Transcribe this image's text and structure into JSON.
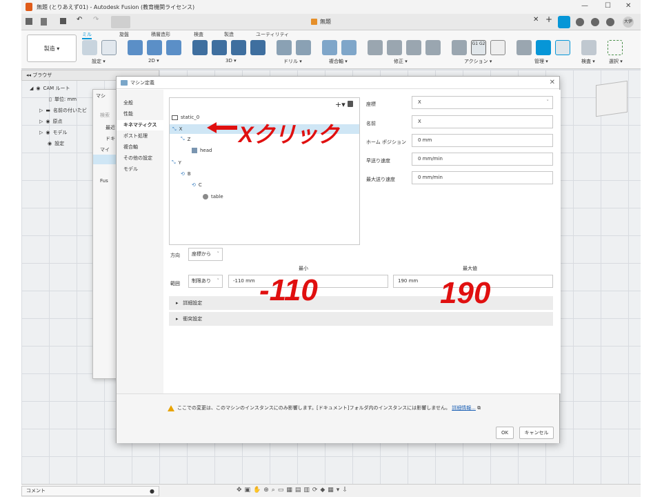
{
  "window": {
    "title": "無題 (とりあえず01) - Autodesk Fusion (教育機関ライセンス)",
    "doc_tab": "無題",
    "user_initials": "大伊"
  },
  "toolbar": {
    "workspace": "製造 ▾",
    "tabs": [
      "ミル",
      "旋盤",
      "積層造形",
      "検査",
      "製造",
      "ユーティリティ"
    ],
    "groups": [
      "設定 ▾",
      "2D ▾",
      "3D ▾",
      "ドリル ▾",
      "複合軸 ▾",
      "修正 ▾",
      "アクション ▾",
      "管理 ▾",
      "検査 ▾",
      "選択 ▾"
    ]
  },
  "browser": {
    "title": "ブラウザ",
    "items": [
      "CAM ルート",
      "単位: mm",
      "名前の付いたビ",
      "原点",
      "モデル",
      "設定"
    ]
  },
  "bg_dialog": {
    "title": "マシ",
    "labels": [
      "検索",
      "最近",
      "ドキ",
      "マイ",
      "Fus"
    ]
  },
  "dialog": {
    "title": "マシン定義",
    "sidebar": [
      "全般",
      "性能",
      "キネマティクス",
      "ポスト処理",
      "複合軸",
      "その他の設定",
      "モデル"
    ],
    "tree": [
      "static_0",
      "X",
      "Z",
      "head",
      "Y",
      "B",
      "C",
      "table"
    ],
    "props": {
      "axis_label": "座標",
      "axis_value": "X",
      "name_label": "名前",
      "name_value": "X",
      "home_label": "ホーム ポジション",
      "home_value": "0 mm",
      "rapid_label": "早送り速度",
      "rapid_value": "0 mm/min",
      "max_feed_label": "最大送り速度",
      "max_feed_value": "0 mm/min"
    },
    "direction_label": "方向",
    "direction_value": "座標から",
    "range_label": "範囲",
    "range_mode": "制限あり",
    "min_label": "最小",
    "min_value": "-110 mm",
    "max_label": "最大値",
    "max_value": "190 mm",
    "advanced": "詳細設定",
    "collision": "衝突設定",
    "warning": "ここでの変更は、このマシンのインスタンスにのみ影響します。[ドキュメント]フォルダ内のインスタンスには影響しません。",
    "warning_link": "詳細情報...",
    "ok": "OK",
    "cancel": "キャンセル"
  },
  "annotations": {
    "x_click": "Xクリック",
    "min": "-110",
    "max": "190"
  },
  "bottom": {
    "comment": "コメント"
  },
  "colors": {
    "annotation": "#e01010",
    "selection": "#cfe6f5",
    "accent": "#0696d7"
  }
}
